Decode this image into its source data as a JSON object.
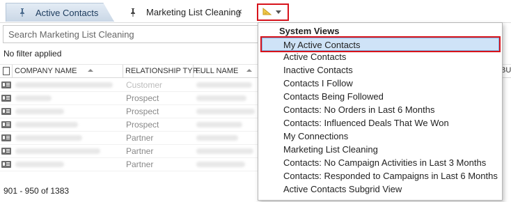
{
  "tabs": [
    {
      "label": "Active Contacts",
      "pinned": true,
      "active": false
    },
    {
      "label": "Marketing List Cleaning",
      "pinned": true,
      "active": true
    }
  ],
  "close_glyph": "×",
  "view_selector": {
    "icon": "view-selector-icon"
  },
  "search": {
    "placeholder": "Search Marketing List Cleaning"
  },
  "filter_status": "No filter applied",
  "grid": {
    "columns": [
      "COMPANY NAME",
      "RELATIONSHIP TYP...",
      "FULL NAME",
      "BUS"
    ],
    "rows": [
      {
        "relationship": "Customer"
      },
      {
        "relationship": "Prospect"
      },
      {
        "relationship": "Prospect"
      },
      {
        "relationship": "Prospect"
      },
      {
        "relationship": "Partner"
      },
      {
        "relationship": "Partner"
      },
      {
        "relationship": "Partner"
      }
    ]
  },
  "pager": {
    "range": "901 - 950 of 1383"
  },
  "views_menu": {
    "header": "System Views",
    "items": [
      "My Active Contacts",
      "Active Contacts",
      "Inactive Contacts",
      "Contacts I Follow",
      "Contacts Being Followed",
      "Contacts: No Orders in Last 6 Months",
      "Contacts: Influenced Deals That We Won",
      "My Connections",
      "Marketing List Cleaning",
      "Contacts: No Campaign Activities in Last 3 Months",
      "Contacts: Responded to Campaigns in Last 6 Months",
      "Active Contacts Subgrid View"
    ],
    "selected": "My Active Contacts"
  },
  "colors": {
    "highlight_border": "#d7131b",
    "selected_bg": "#cfe3f7"
  }
}
